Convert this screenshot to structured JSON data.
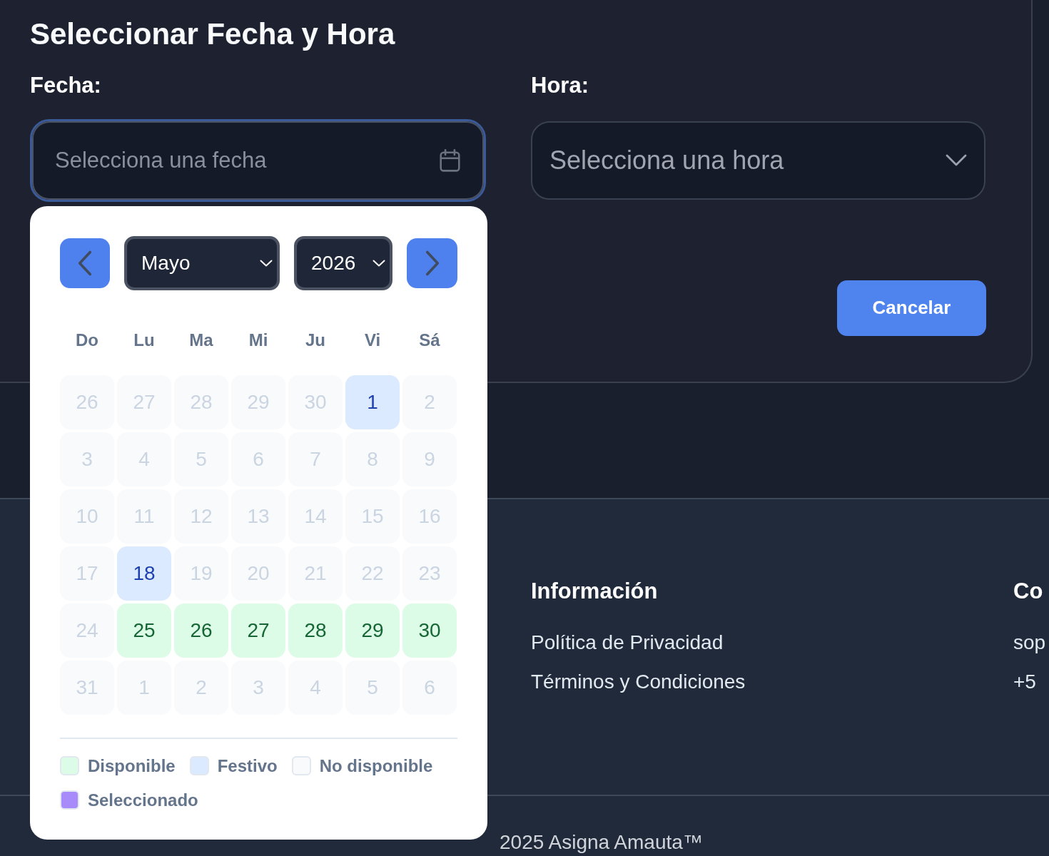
{
  "dialog": {
    "title": "Seleccionar Fecha y Hora",
    "date_field": {
      "label": "Fecha:",
      "placeholder": "Selecciona una fecha",
      "focused": true
    },
    "time_field": {
      "label": "Hora:",
      "placeholder": "Selecciona una hora",
      "focused": false
    },
    "cancel_button": "Cancelar"
  },
  "calendar": {
    "open": true,
    "month": "Mayo",
    "year": "2026",
    "weekdays": [
      "Do",
      "Lu",
      "Ma",
      "Mi",
      "Ju",
      "Vi",
      "Sá"
    ],
    "days": [
      {
        "day": "26",
        "kind": "unavailable",
        "selected": false
      },
      {
        "day": "27",
        "kind": "unavailable",
        "selected": false
      },
      {
        "day": "28",
        "kind": "unavailable",
        "selected": false
      },
      {
        "day": "29",
        "kind": "unavailable",
        "selected": false
      },
      {
        "day": "30",
        "kind": "unavailable",
        "selected": false
      },
      {
        "day": "1",
        "kind": "holiday",
        "selected": false
      },
      {
        "day": "2",
        "kind": "unavailable",
        "selected": false
      },
      {
        "day": "3",
        "kind": "unavailable",
        "selected": false
      },
      {
        "day": "4",
        "kind": "unavailable",
        "selected": false
      },
      {
        "day": "5",
        "kind": "unavailable",
        "selected": false
      },
      {
        "day": "6",
        "kind": "unavailable",
        "selected": false
      },
      {
        "day": "7",
        "kind": "unavailable",
        "selected": false
      },
      {
        "day": "8",
        "kind": "unavailable",
        "selected": false
      },
      {
        "day": "9",
        "kind": "unavailable",
        "selected": false
      },
      {
        "day": "10",
        "kind": "unavailable",
        "selected": false
      },
      {
        "day": "11",
        "kind": "unavailable",
        "selected": false
      },
      {
        "day": "12",
        "kind": "unavailable",
        "selected": false
      },
      {
        "day": "13",
        "kind": "unavailable",
        "selected": false
      },
      {
        "day": "14",
        "kind": "unavailable",
        "selected": false
      },
      {
        "day": "15",
        "kind": "unavailable",
        "selected": false
      },
      {
        "day": "16",
        "kind": "unavailable",
        "selected": false
      },
      {
        "day": "17",
        "kind": "unavailable",
        "selected": false
      },
      {
        "day": "18",
        "kind": "holiday",
        "selected": false
      },
      {
        "day": "19",
        "kind": "unavailable",
        "selected": false
      },
      {
        "day": "20",
        "kind": "unavailable",
        "selected": false
      },
      {
        "day": "21",
        "kind": "unavailable",
        "selected": false
      },
      {
        "day": "22",
        "kind": "unavailable",
        "selected": false
      },
      {
        "day": "23",
        "kind": "unavailable",
        "selected": false
      },
      {
        "day": "24",
        "kind": "unavailable",
        "selected": false
      },
      {
        "day": "25",
        "kind": "available",
        "selected": false
      },
      {
        "day": "26",
        "kind": "available",
        "selected": false
      },
      {
        "day": "27",
        "kind": "available",
        "selected": false
      },
      {
        "day": "28",
        "kind": "available",
        "selected": false
      },
      {
        "day": "29",
        "kind": "available",
        "selected": false
      },
      {
        "day": "30",
        "kind": "available",
        "selected": false
      },
      {
        "day": "31",
        "kind": "unavailable",
        "selected": false
      },
      {
        "day": "1",
        "kind": "unavailable",
        "selected": false
      },
      {
        "day": "2",
        "kind": "unavailable",
        "selected": false
      },
      {
        "day": "3",
        "kind": "unavailable",
        "selected": false
      },
      {
        "day": "4",
        "kind": "unavailable",
        "selected": false
      },
      {
        "day": "5",
        "kind": "unavailable",
        "selected": false
      },
      {
        "day": "6",
        "kind": "unavailable",
        "selected": false
      }
    ],
    "legend": [
      {
        "label": "Disponible",
        "color": "#dcfce7"
      },
      {
        "label": "Festivo",
        "color": "#dbeafe"
      },
      {
        "label": "No disponible",
        "color": "#f8fafc"
      },
      {
        "label": "Seleccionado",
        "color": "#a78bfa"
      }
    ]
  },
  "footer": {
    "columns": [
      {
        "heading": "Información",
        "items": [
          "Política de Privacidad",
          "Términos y Condiciones"
        ]
      },
      {
        "heading": "Co",
        "items": [
          "sop",
          "+5"
        ]
      }
    ],
    "copyright": "2025 Asigna Amauta™"
  }
}
